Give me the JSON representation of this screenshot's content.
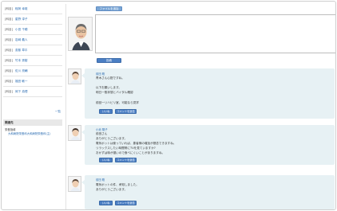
{
  "sidebar": {
    "items": [
      {
        "tag": "[科目]",
        "name": "稲荷 幸雄"
      },
      {
        "tag": "[科目]",
        "name": "星野 淳子"
      },
      {
        "tag": "[科目]",
        "name": "小田 千穂"
      },
      {
        "tag": "[科目]",
        "name": "岩崎 義人"
      },
      {
        "tag": "[科目]",
        "name": "斎藤 章平"
      },
      {
        "tag": "[科目]",
        "name": "竹本 秀樹"
      },
      {
        "tag": "[科目]",
        "name": "佐川 亮輔"
      },
      {
        "tag": "[科目]",
        "name": "福田 敏一"
      },
      {
        "tag": "[科目]",
        "name": "岡下 真理"
      }
    ],
    "more": "一覧",
    "section_title": "関連先",
    "note_title": "栄養指導",
    "note_link": "大和病院栄養科大和病院栄養科(主)"
  },
  "compose": {
    "top_button": "ファイルを追加",
    "post_button": "投稿"
  },
  "comments": [
    {
      "author": "前田 聡",
      "lines": [
        "青木さん心配ですね。",
        "",
        "以下お願いします。",
        "明日一般状態とバイタル確認",
        "",
        "前回一リハビリ室、可能なら見学"
      ],
      "btn1": "いいね",
      "btn2": "コメントを返信"
    },
    {
      "author": "小池 陽子",
      "lines": [
        "前田さん",
        "ありがとうございます。",
        "電気ポットは使っていれば、患者様の増加が懸念できますね。",
        "リラックスしたい時間帯にTVを見ていますか?",
        "おかずは味が濃いので食べにくいことがありますね。"
      ],
      "btn1": "いいね",
      "btn2": "コメントを返信"
    },
    {
      "author": "前田 聡",
      "lines": [
        "電気ポットの件、承知しました。",
        "ありがとうございます。"
      ],
      "btn1": "いいね",
      "btn2": "コメントを返信"
    }
  ]
}
